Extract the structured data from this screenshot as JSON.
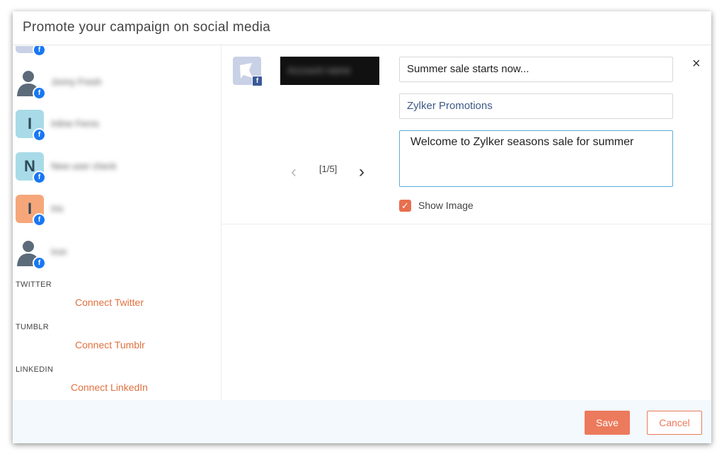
{
  "dialog": {
    "title": "Promote your campaign on social media"
  },
  "accounts": [
    {
      "initial": "",
      "name": "",
      "avatar_type": "partial",
      "color": "#c9d1e6"
    },
    {
      "initial": "",
      "name": "Jonny Fresh",
      "avatar_type": "silhouette",
      "color": "#5c6b7a"
    },
    {
      "initial": "I",
      "name": "Inline Ferns",
      "avatar_type": "initial",
      "color": "#a8dbe7"
    },
    {
      "initial": "N",
      "name": "New user check",
      "avatar_type": "initial",
      "color": "#a8dbe7"
    },
    {
      "initial": "I",
      "name": "Iris",
      "avatar_type": "initial",
      "color": "#f5a77a"
    },
    {
      "initial": "",
      "name": "Iron",
      "avatar_type": "silhouette",
      "color": "#5c6b7a"
    }
  ],
  "badge_label": "f",
  "sections": [
    {
      "label": "TWITTER",
      "link": "Connect Twitter"
    },
    {
      "label": "TUMBLR",
      "link": "Connect Tumblr"
    },
    {
      "label": "LINKEDIN",
      "link": "Connect LinkedIn"
    }
  ],
  "post": {
    "preview_text": "Account name",
    "pager": {
      "prev": "‹",
      "count": "[1/5]",
      "next": "›"
    },
    "title_value": "Summer sale starts now...",
    "page_value": "Zylker Promotions",
    "message_value": "Welcome to Zylker seasons sale for summer",
    "show_image_label": "Show Image",
    "show_image_checked": true,
    "close_symbol": "×",
    "check_symbol": "✓"
  },
  "footer": {
    "save_label": "Save",
    "cancel_label": "Cancel"
  },
  "colors": {
    "accent": "#ec7a5c",
    "link": "#e2703f",
    "facebook": "#1877f2",
    "focus": "#5aaed9"
  }
}
